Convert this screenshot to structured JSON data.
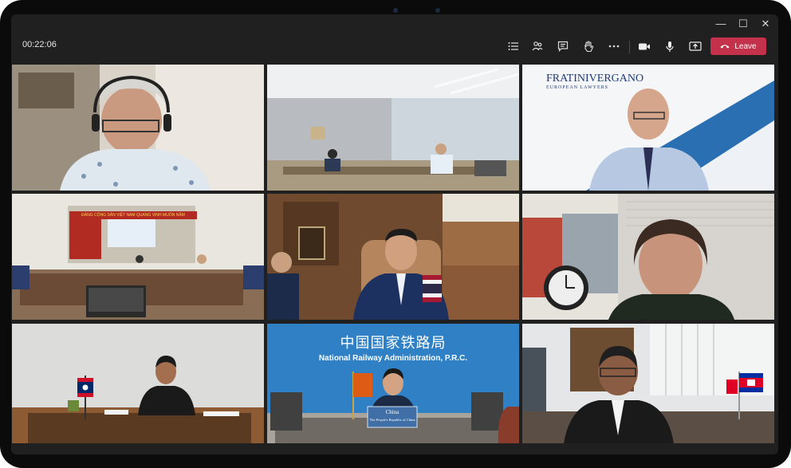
{
  "toolbar": {
    "timer": "00:22:06",
    "leave_label": "Leave"
  },
  "window_controls": {
    "minimize": "—",
    "maximize": "☐",
    "close": "✕"
  },
  "icons": [
    "list-icon",
    "people-icon",
    "chat-icon",
    "raise-hand-icon",
    "more-icon",
    "camera-icon",
    "microphone-icon",
    "share-screen-icon",
    "phone-hangup-icon"
  ],
  "tiles": {
    "t6": {
      "logo_main": "FRATINIVERGANO",
      "logo_sub": "EUROPEAN LAWYERS"
    },
    "t8": {
      "banner_cn": "中国国家铁路局",
      "banner_en": "National Railway Administration, P.R.C.",
      "nameplate_title": "China",
      "nameplate_sub": "The People's Republic of China"
    },
    "t7": {
      "banner_text": "ĐẢNG CỘNG SẢN VIỆT NAM QUANG VINH MUÔN NĂM"
    }
  },
  "colors": {
    "leave": "#c4314b",
    "toolbar_bg": "#202020",
    "device_frame": "#0b0b0c"
  }
}
